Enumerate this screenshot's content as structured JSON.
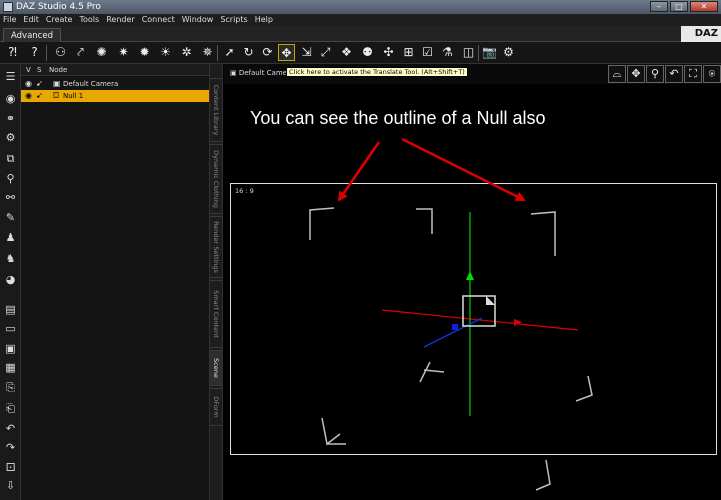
{
  "window": {
    "title": "DAZ Studio 4.5 Pro"
  },
  "menubar": {
    "items": [
      "File",
      "Edit",
      "Create",
      "Tools",
      "Render",
      "Connect",
      "Window",
      "Scripts",
      "Help"
    ]
  },
  "tabs": {
    "active_label": "Advanced"
  },
  "brand": {
    "logo_text": "DAZ"
  },
  "toolbar": {
    "tooltip": "Click here to activate the Translate Tool. (Alt+Shift+T)",
    "active_tool_icon": "translate-icon",
    "accent_color": "#c9a400"
  },
  "scene": {
    "headers": {
      "visible": "V",
      "selectable": "S",
      "node": "Node"
    },
    "rows": [
      {
        "label": "Default Camera",
        "selected": false
      },
      {
        "label": "Null 1",
        "selected": true
      }
    ],
    "selection_color": "#e8a800"
  },
  "side_tabs": [
    "Content Library",
    "Dynamic Clothing",
    "Render Settings",
    "Smart Content",
    "Scene",
    "DForm"
  ],
  "viewport": {
    "camera_label": "Default Camera",
    "aspect_label": "16 : 9",
    "annotation": "You can see the outline of a Null also",
    "arrow_color": "#e00000"
  }
}
